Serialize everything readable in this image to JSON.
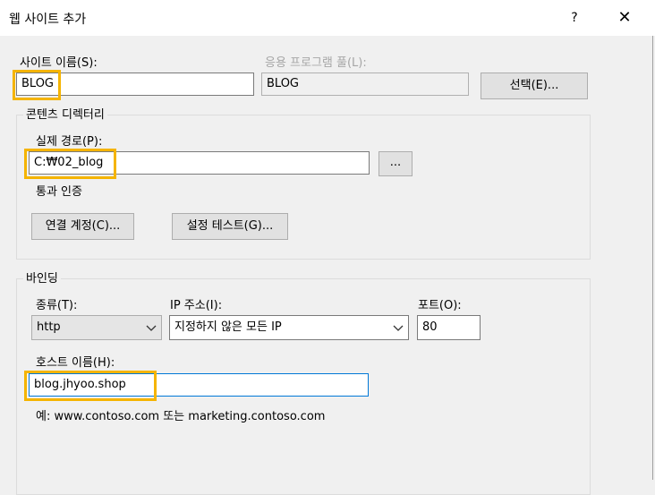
{
  "window": {
    "title": "웹 사이트 추가",
    "help_label": "?",
    "close_label": "✕"
  },
  "site": {
    "name_label": "사이트 이름(S):",
    "name_value": "BLOG",
    "pool_label": "응용 프로그램 풀(L):",
    "pool_value": "BLOG",
    "select_button": "선택(E)..."
  },
  "content": {
    "group_label": "콘텐츠 디렉터리",
    "path_label": "실제 경로(P):",
    "path_value": "C:₩02_blog",
    "browse_button": "...",
    "auth_label": "통과 인증",
    "connect_as_button": "연결 계정(C)...",
    "test_settings_button": "설정 테스트(G)..."
  },
  "binding": {
    "group_label": "바인딩",
    "type_label": "종류(T):",
    "type_value": "http",
    "ip_label": "IP 주소(I):",
    "ip_value": "지정하지 않은 모든 IP",
    "port_label": "포트(O):",
    "port_value": "80",
    "host_label": "호스트 이름(H):",
    "host_value": "blog.jhyoo.shop",
    "example_text": "예: www.contoso.com 또는 marketing.contoso.com"
  },
  "colors": {
    "highlight": "#f5b400",
    "focus_border": "#0078d7",
    "dialog_bg": "#f0f0f0"
  }
}
